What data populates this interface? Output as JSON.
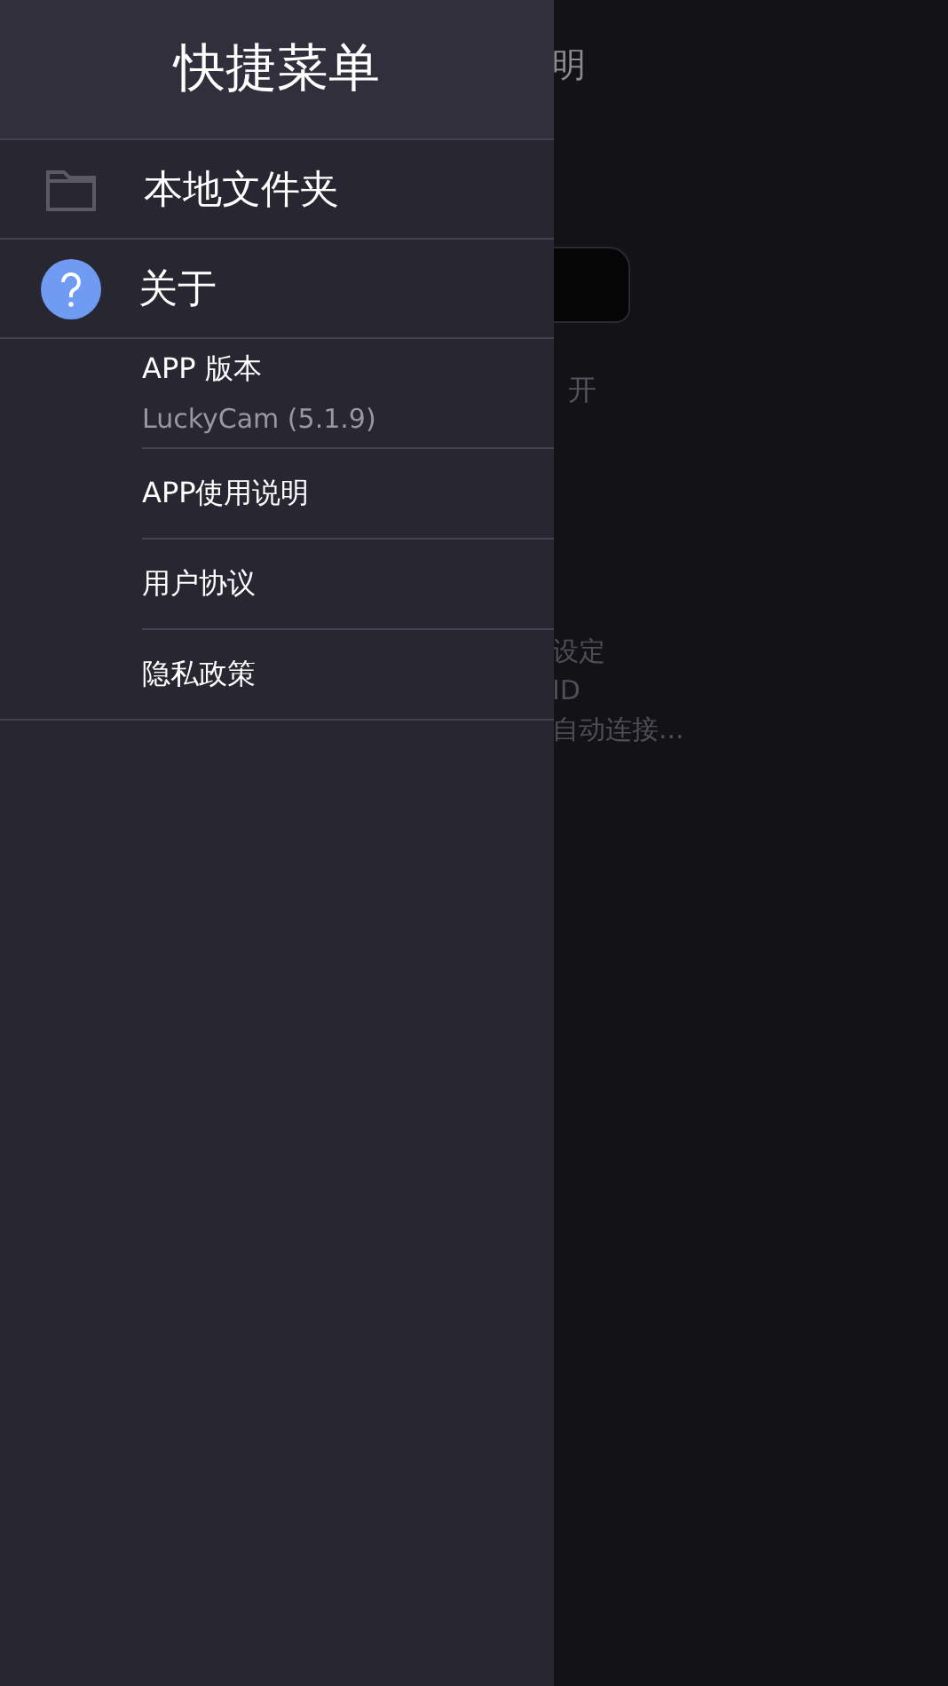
{
  "background": {
    "texts": [
      {
        "kind": "title",
        "text": "明"
      },
      {
        "kind": "status",
        "text": "开"
      },
      {
        "kind": "info",
        "text": "设定"
      },
      {
        "kind": "info",
        "text": "ID"
      },
      {
        "kind": "info",
        "text": "自动连接..."
      }
    ]
  },
  "drawer": {
    "title": "快捷菜单",
    "items": [
      {
        "kind": "folder",
        "label": "本地文件夹"
      },
      {
        "kind": "help",
        "label": "关于"
      }
    ],
    "about_entries": [
      {
        "title": "APP 版本",
        "subtitle": "LuckyCam (5.1.9)"
      },
      {
        "title": "APP使用说明"
      },
      {
        "title": "用户协议"
      },
      {
        "title": "隐私政策"
      }
    ]
  }
}
